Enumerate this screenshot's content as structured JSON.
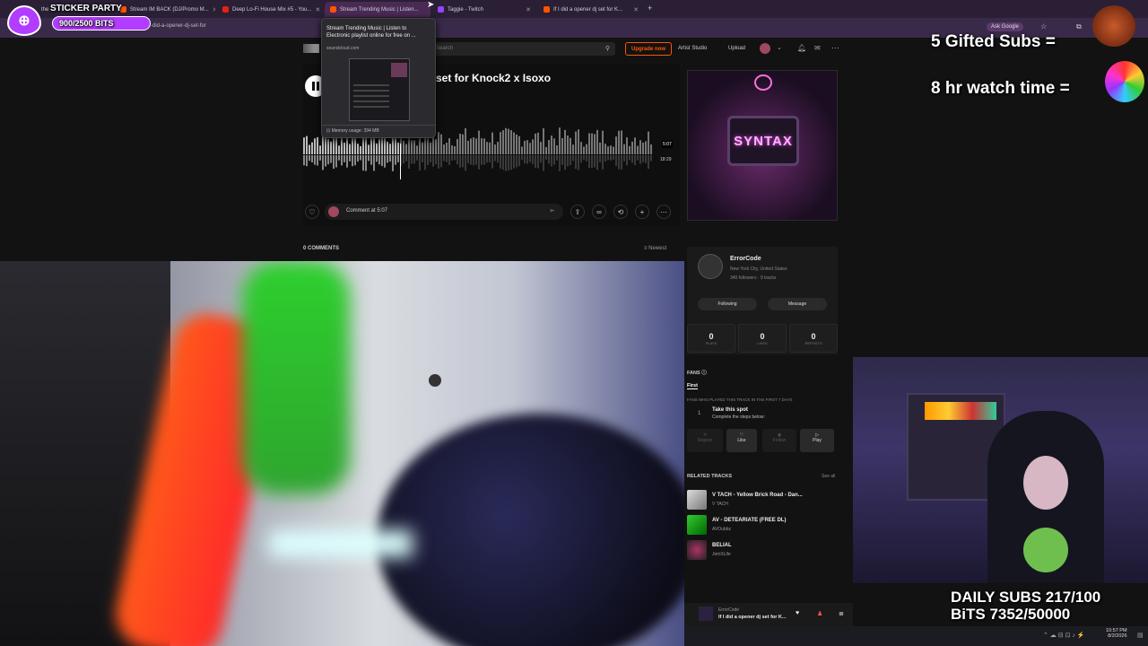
{
  "browser": {
    "tabs": [
      {
        "title": "the",
        "active": false
      },
      {
        "title": "Stream IM BACK (DJ/Promo M...",
        "active": false
      },
      {
        "title": "Deep Lo-Fi House Mix #5 - You...",
        "active": false
      },
      {
        "title": "Stream Trending Music | Listen...",
        "active": true
      },
      {
        "title": "Taggie - Twitch",
        "active": false
      },
      {
        "title": "If I did a opener dj set for K...",
        "active": false
      }
    ],
    "new_tab": "+",
    "url": "-did-a-opener-dj-set-for",
    "ask_google": "Ask Google"
  },
  "tooltip": {
    "title": "Stream Trending Music | Listen to Electronic playlist online for free on ...",
    "domain": "soundcloud.com",
    "memory": "Memory usage: 394 MB"
  },
  "soundcloud": {
    "search_placeholder": "Search",
    "upgrade": "Upgrade now",
    "artist_studio": "Artist Studio",
    "upload": "Upload",
    "track_title": "set for Knock2 x Isoxo",
    "time_current": "5:07",
    "time_total": "18:29",
    "comment_placeholder": "Comment at 5:07",
    "comments_count": "0 COMMENTS",
    "newest": "Newest",
    "artwork_text": "SYNTAX",
    "artist": {
      "name": "ErrorCode",
      "location": "New York City, United States",
      "stats": "340 followers · 9 tracks",
      "following": "Following",
      "message": "Message"
    },
    "track_stats": [
      {
        "value": "0",
        "label": "PLAYS"
      },
      {
        "value": "0",
        "label": "LIKES"
      },
      {
        "value": "0",
        "label": "REPOSTS"
      }
    ],
    "fans": {
      "header": "FANS",
      "tab": "First",
      "sub": "FANS WHO PLAYED THIS TRACK IN THE FIRST 7 DAYS",
      "rank": "1",
      "spot": "Take this spot",
      "steps": "Complete the steps below:",
      "actions": [
        "Repost",
        "Like",
        "Follow",
        "Play"
      ]
    },
    "related": {
      "header": "RELATED TRACKS",
      "see_all": "See all",
      "items": [
        {
          "title": "V TACH - Yellow Brick Road - Dan...",
          "artist": "V TACH"
        },
        {
          "title": "AV - DETEARIATE (FREE DL)",
          "artist": "AVOubbz"
        },
        {
          "title": "BELIAL",
          "artist": "JetriXLife"
        }
      ]
    },
    "player": {
      "artist": "ErrorCode",
      "title": "If I did a opener dj set for K..."
    }
  },
  "overlays": {
    "sticker_party": "STICKER PARTY",
    "bits_goal": "900/2500 BITS",
    "gifted_subs": "5 Gifted Subs =",
    "watch_time": "8 hr watch time =",
    "daily_subs": "DAILY SUBS 217/100",
    "bits": "BiTS 7352/50000"
  },
  "taskbar": {
    "time": "10:57 PM",
    "date": "8/2/2026"
  },
  "colors": {
    "accent": "#ff5500",
    "tab_active": "#4a2a55",
    "overlay_purple": "#b23cff"
  }
}
